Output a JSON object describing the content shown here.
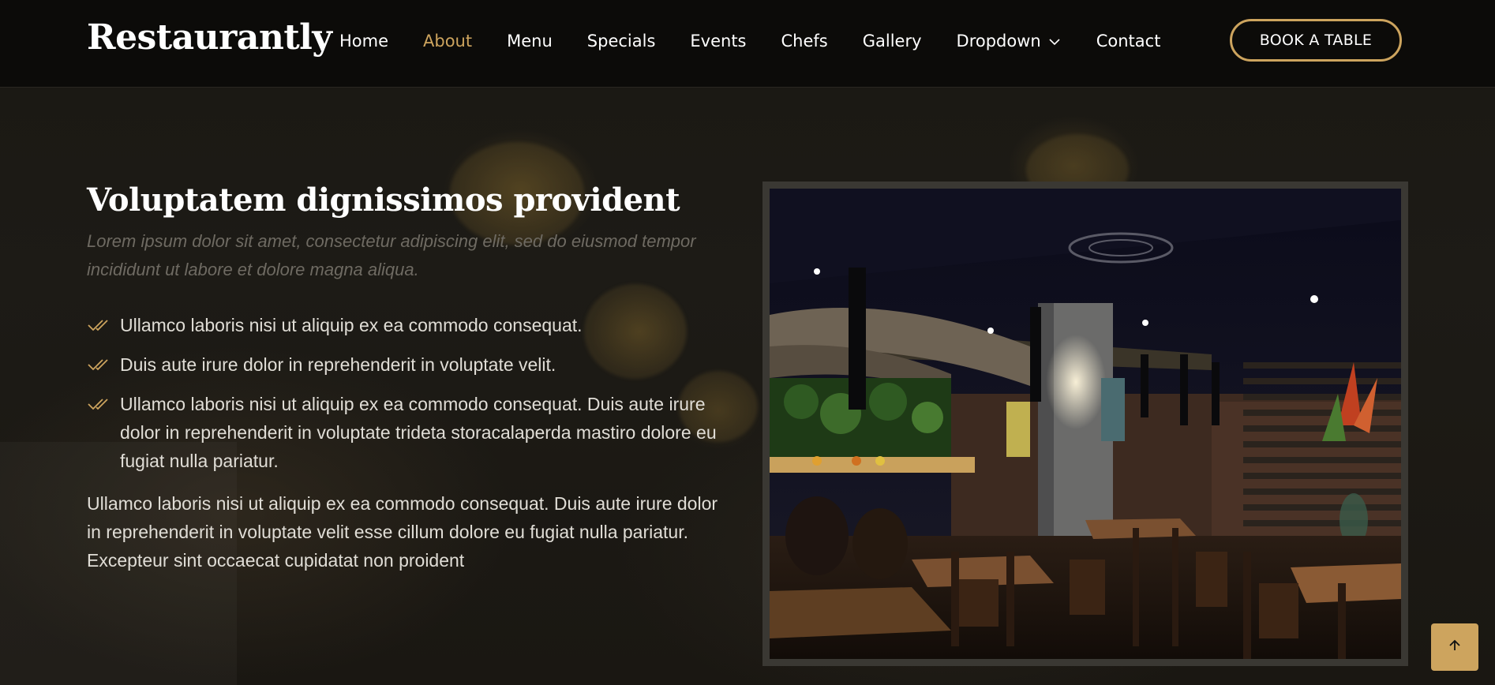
{
  "header": {
    "logo": "Restaurantly",
    "nav": [
      {
        "label": "Home",
        "active": false
      },
      {
        "label": "About",
        "active": true
      },
      {
        "label": "Menu",
        "active": false
      },
      {
        "label": "Specials",
        "active": false
      },
      {
        "label": "Events",
        "active": false
      },
      {
        "label": "Chefs",
        "active": false
      },
      {
        "label": "Gallery",
        "active": false
      },
      {
        "label": "Dropdown",
        "active": false,
        "icon": "chevron-down-icon"
      },
      {
        "label": "Contact",
        "active": false
      }
    ],
    "cta_label": "BOOK A TABLE"
  },
  "about": {
    "title": "Voluptatem dignissimos provident",
    "subtitle": "Lorem ipsum dolor sit amet, consectetur adipiscing elit, sed do eiusmod tempor incididunt ut labore et dolore magna aliqua.",
    "checklist": [
      "Ullamco laboris nisi ut aliquip ex ea commodo consequat.",
      "Duis aute irure dolor in reprehenderit in voluptate velit.",
      "Ullamco laboris nisi ut aliquip ex ea commodo consequat. Duis aute irure dolor in reprehenderit in voluptate trideta storacalaperda mastiro dolore eu fugiat nulla pariatur."
    ],
    "paragraph": "Ullamco laboris nisi ut aliquip ex ea commodo consequat. Duis aute irure dolor in reprehenderit in voluptate velit esse cillum dolore eu fugiat nulla pariatur. Excepteur sint occaecat cupidatat non proident",
    "check_icon": "double-check-icon",
    "image": "restaurant-interior-photo"
  },
  "back_to_top_icon": "arrow-up-icon",
  "colors": {
    "accent": "#cda45e",
    "header_bg": "#0c0b09",
    "page_bg": "#1a1813",
    "text": "#e0ddd6",
    "muted": "#6e6a62"
  }
}
